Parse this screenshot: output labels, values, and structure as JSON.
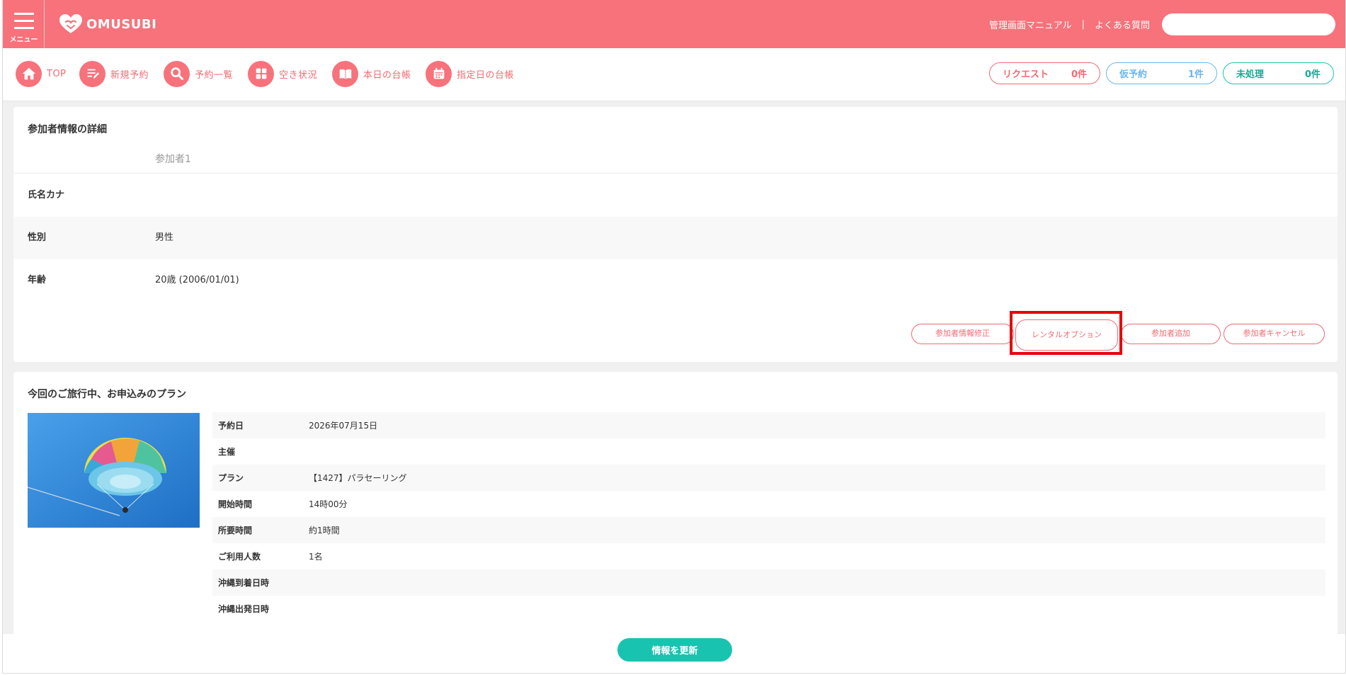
{
  "header": {
    "menu_label": "メニュー",
    "logo_text": "OMUSUBI",
    "links": [
      "管理画面マニュアル",
      "よくある質問"
    ],
    "separator": "|",
    "search_placeholder": ""
  },
  "nav": {
    "items": [
      {
        "label": "TOP",
        "icon": "home-icon"
      },
      {
        "label": "新規予約",
        "icon": "edit-list-icon"
      },
      {
        "label": "予約一覧",
        "icon": "search-icon"
      },
      {
        "label": "空き状況",
        "icon": "grid-icon"
      },
      {
        "label": "本日の台帳",
        "icon": "book-icon"
      },
      {
        "label": "指定日の台帳",
        "icon": "calendar-icon"
      }
    ],
    "status": {
      "request": {
        "label": "リクエスト",
        "count": "0件",
        "color": "#f26a72"
      },
      "temporary": {
        "label": "仮予約",
        "count": "1件",
        "color": "#6bb6ee"
      },
      "unprocessed": {
        "label": "未処理",
        "count": "0件",
        "color": "#1aa894"
      }
    }
  },
  "participant": {
    "title": "参加者情報の詳細",
    "sub_label": "参加者1",
    "rows": [
      {
        "key": "氏名カナ",
        "value": ""
      },
      {
        "key": "性別",
        "value": "男性"
      },
      {
        "key": "年齢",
        "value": "20歳 (2006/01/01)"
      }
    ],
    "actions": {
      "edit": "参加者情報修正",
      "rental": "レンタルオプション",
      "add": "参加者追加",
      "cancel": "参加者キャンセル"
    }
  },
  "plan": {
    "title": "今回のご旅行中、お申込みのプラン",
    "rows": [
      {
        "key": "予約日",
        "value": "2026年07月15日"
      },
      {
        "key": "主催",
        "value": ""
      },
      {
        "key": "プラン",
        "value": "【1427】パラセーリング"
      },
      {
        "key": "開始時間",
        "value": "14時00分"
      },
      {
        "key": "所要時間",
        "value": "約1時間"
      },
      {
        "key": "ご利用人数",
        "value": "1名"
      },
      {
        "key": "沖縄到着日時",
        "value": ""
      },
      {
        "key": "沖縄出発日時",
        "value": ""
      }
    ]
  },
  "footer": {
    "update_label": "情報を更新"
  },
  "colors": {
    "brand": "#f7727b",
    "accent_teal": "#18c3b0",
    "highlight": "#e8000b"
  }
}
